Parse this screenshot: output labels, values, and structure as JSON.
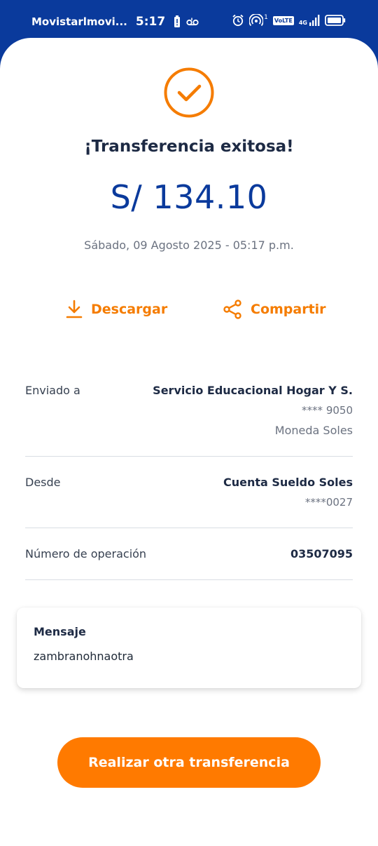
{
  "status_bar": {
    "carrier": "Movistarlmovi...",
    "time": "5:17",
    "network": "4G",
    "volte": "VoLTE",
    "hotspot_count": "1"
  },
  "receipt": {
    "title": "¡Transferencia exitosa!",
    "amount": "S/ 134.10",
    "datetime": "Sábado, 09 Agosto 2025 - 05:17 p.m.",
    "status_color": "#f57c00"
  },
  "actions": {
    "download_label": "Descargar",
    "share_label": "Compartir"
  },
  "details": {
    "sent_to": {
      "label": "Enviado a",
      "name": "Servicio Educacional Hogar Y S.",
      "account": "**** 9050",
      "currency": "Moneda Soles"
    },
    "from": {
      "label": "Desde",
      "account_name": "Cuenta Sueldo Soles",
      "account": "****0027"
    },
    "operation": {
      "label": "Número de operación",
      "number": "03507095"
    }
  },
  "message": {
    "title": "Mensaje",
    "text": "zambranohnaotra"
  },
  "cta": {
    "label": "Realizar otra transferencia"
  }
}
